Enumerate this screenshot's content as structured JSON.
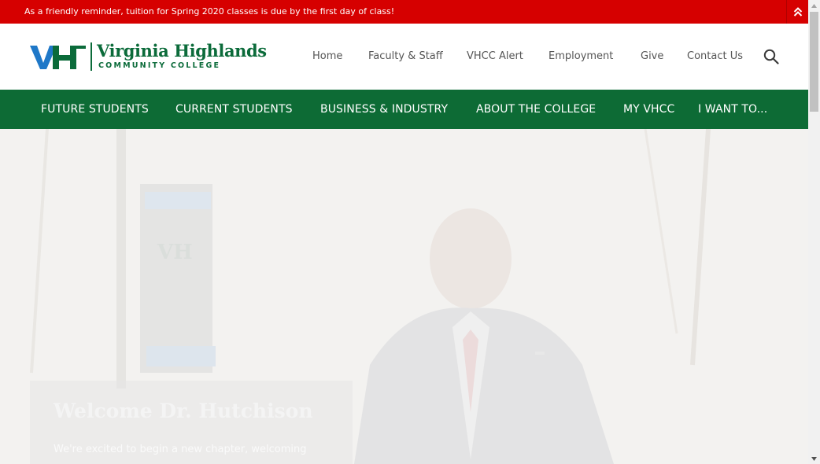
{
  "alert": {
    "message": "As a friendly reminder, tuition for Spring 2020 classes is due by the first day of class!",
    "toggle_icon": "double-chevron-up-icon",
    "color": "#d60000"
  },
  "logo": {
    "name": "Virginia Highlands",
    "subtitle": "COMMUNITY COLLEGE",
    "brand_green": "#0b6b3a",
    "brand_blue": "#1f78c8"
  },
  "utility_nav": [
    {
      "label": "Home"
    },
    {
      "label": "Faculty & Staff"
    },
    {
      "label": "VHCC Alert"
    },
    {
      "label": "Employment"
    },
    {
      "label": "Give"
    },
    {
      "label": "Contact Us"
    }
  ],
  "search": {
    "icon": "search-icon"
  },
  "main_nav": {
    "color": "#0d6b35",
    "items": [
      {
        "label": "FUTURE STUDENTS"
      },
      {
        "label": "CURRENT STUDENTS"
      },
      {
        "label": "BUSINESS & INDUSTRY"
      },
      {
        "label": "ABOUT THE COLLEGE"
      },
      {
        "label": "MY VHCC"
      },
      {
        "label": "I WANT TO..."
      }
    ]
  },
  "hero": {
    "title": "Welcome Dr. Hutchison",
    "body": "We're excited to begin a new chapter, welcoming"
  }
}
